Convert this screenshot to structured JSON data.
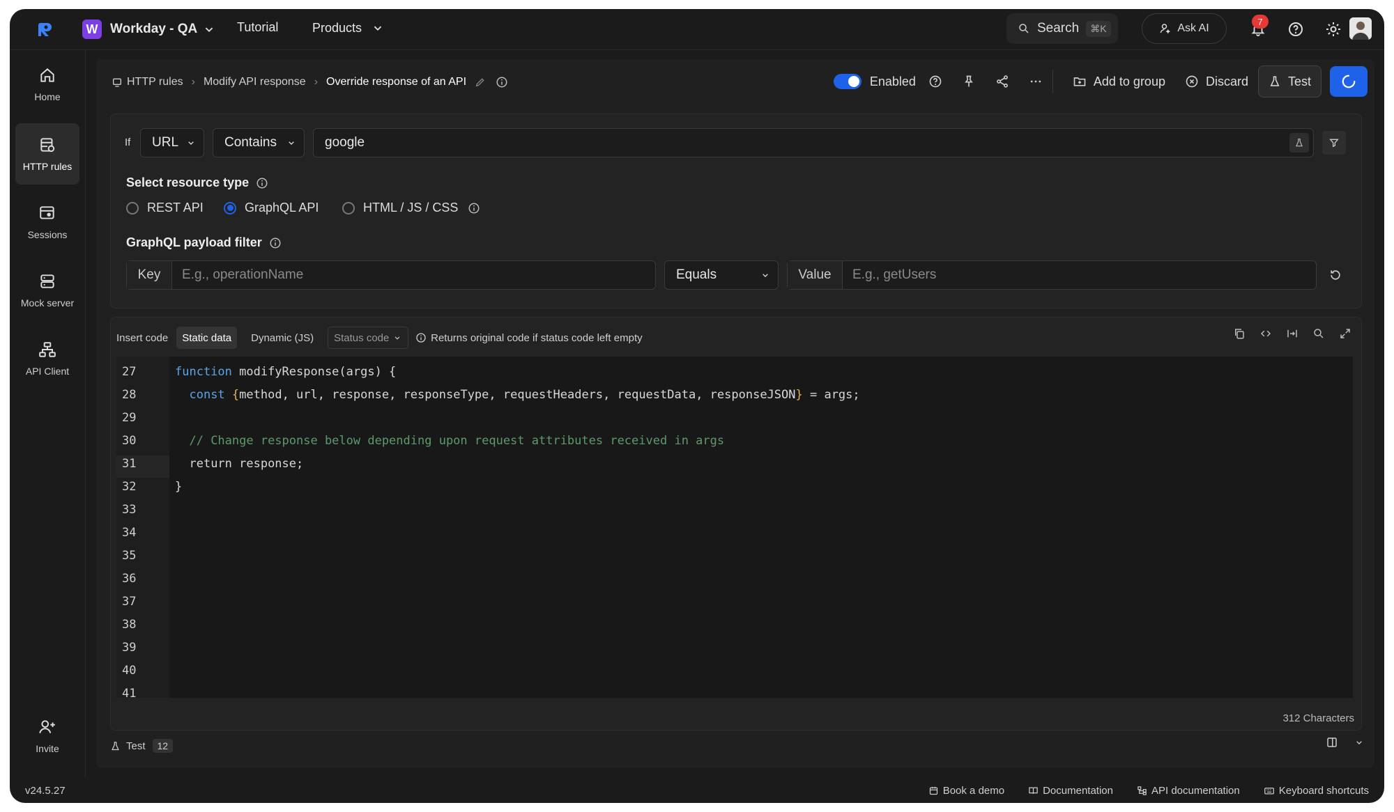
{
  "topbar": {
    "workspace_initial": "W",
    "workspace_name": "Workday - QA",
    "nav": [
      "Tutorial",
      "Products"
    ],
    "search_label": "Search",
    "search_shortcut": "⌘K",
    "ask_ai_label": "Ask AI",
    "notification_count": "7",
    "accent_color": "#1d62e8"
  },
  "sidebar": {
    "items": [
      {
        "label": "Home",
        "icon": "home-icon"
      },
      {
        "label": "HTTP rules",
        "icon": "http-rules-icon"
      },
      {
        "label": "Sessions",
        "icon": "sessions-icon"
      },
      {
        "label": "Mock server",
        "icon": "mock-server-icon"
      },
      {
        "label": "API Client",
        "icon": "api-client-icon"
      }
    ],
    "invite_label": "Invite"
  },
  "breadcrumb": [
    "HTTP rules",
    "Modify API response",
    "Override response of an API"
  ],
  "actions": {
    "enabled_label": "Enabled",
    "add_to_group": "Add to group",
    "discard": "Discard",
    "test": "Test"
  },
  "condition": {
    "if_label": "If",
    "source": "URL",
    "operator": "Contains",
    "value": "google"
  },
  "resource_type": {
    "label": "Select resource type",
    "options": [
      "REST API",
      "GraphQL API",
      "HTML / JS / CSS"
    ],
    "selected": "GraphQL API"
  },
  "graphql_filter": {
    "label": "GraphQL payload filter",
    "key_label": "Key",
    "key_placeholder": "E.g., operationName",
    "operator": "Equals",
    "value_label": "Value",
    "value_placeholder": "E.g., getUsers"
  },
  "editor": {
    "insert_code_label": "Insert code",
    "tabs": [
      "Static data",
      "Dynamic (JS)"
    ],
    "active_tab": "Static data",
    "status_code_placeholder": "Status code",
    "status_hint": "Returns original code if status code left empty",
    "line_numbers": [
      "27",
      "28",
      "29",
      "30",
      "31",
      "32",
      "33",
      "34",
      "35",
      "36",
      "37",
      "38",
      "39",
      "40",
      "41"
    ],
    "lines": {
      "l27_kw": "function",
      "l27_rest": " modifyResponse(args) {",
      "l28_kw": "const",
      "l28_brace_open": "{",
      "l28_mid": "method, url, response, responseType, requestHeaders, requestData, responseJSON",
      "l28_brace_close": "}",
      "l28_end": " = args;",
      "l30_comment": "// Change response below depending upon request attributes received in args",
      "l31": "return response;",
      "l32": "}"
    },
    "char_count": "312 Characters"
  },
  "bottom_panel": {
    "test_label": "Test",
    "test_count": "12"
  },
  "footer": {
    "version": "v24.5.27",
    "links": [
      "Book a demo",
      "Documentation",
      "API documentation",
      "Keyboard shortcuts"
    ]
  }
}
